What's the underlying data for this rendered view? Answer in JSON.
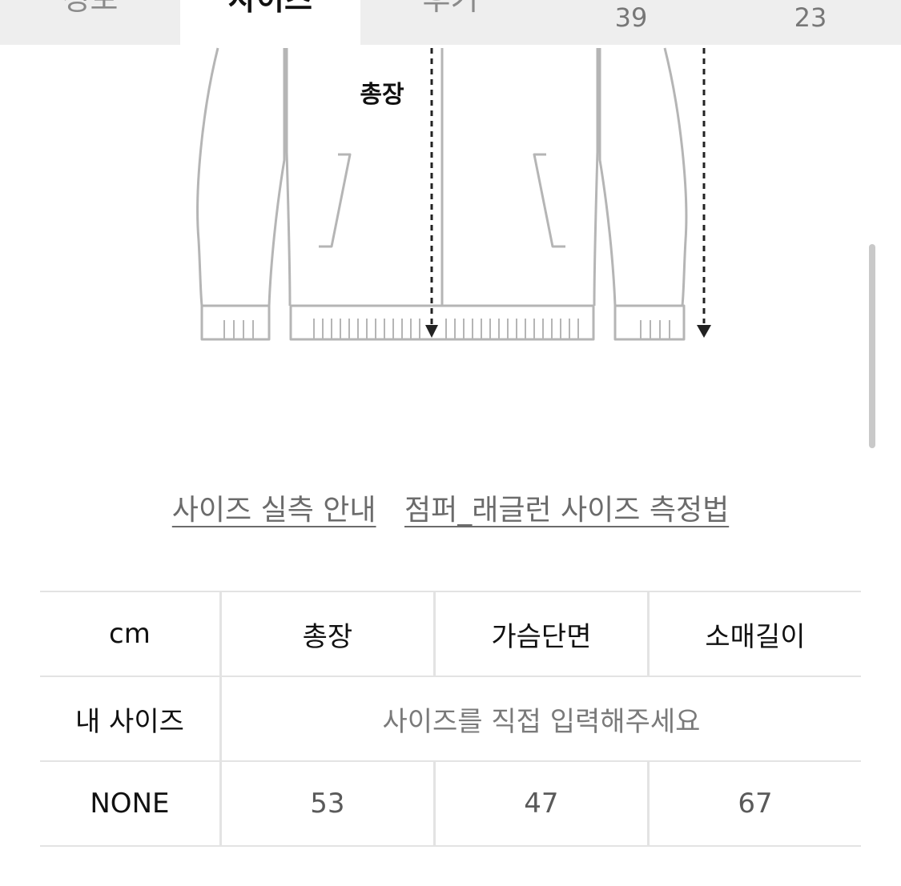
{
  "tabs": {
    "items": [
      {
        "label": "정보"
      },
      {
        "label": "사이즈"
      },
      {
        "label": "후기"
      }
    ],
    "partial_numbers": [
      "39",
      "23"
    ]
  },
  "diagram": {
    "length_label": "총장"
  },
  "guide_links": {
    "actual_size": "사이즈 실측 안내",
    "measure_method": "점퍼_래글런 사이즈 측정법"
  },
  "size_table": {
    "unit": "cm",
    "headers": [
      "총장",
      "가슴단면",
      "소매길이"
    ],
    "my_size_label": "내 사이즈",
    "my_size_placeholder": "사이즈를 직접 입력해주세요",
    "rows": [
      {
        "size": "NONE",
        "values": [
          "53",
          "47",
          "67"
        ]
      }
    ]
  }
}
